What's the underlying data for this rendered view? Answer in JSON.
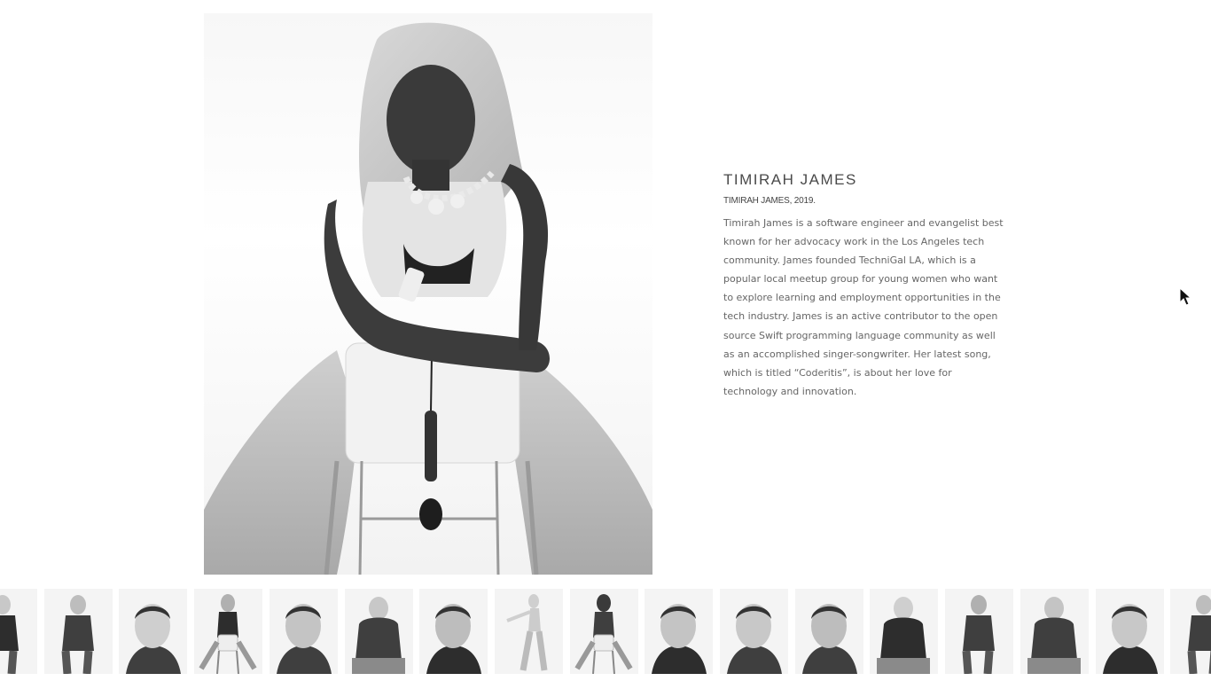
{
  "profile": {
    "name": "TIMIRAH JAMES",
    "caption": "TIMIRAH JAMES, 2019.",
    "bio": "Timirah James is a software engineer and evangelist best known for her advocacy work in the Los Angeles tech community. James founded TechniGal LA, which is a popular local meetup group for young women who want to explore learning and employment opportunities in the tech industry. James is an active contributor to the open source Swift programming language community as well as an accomplished singer-songwriter. Her latest song, which is titled “Coderitis”, is about her love for technology and innovation."
  },
  "main_image": {
    "icon": "portrait-photo-seated-woman"
  },
  "thumbnails": [
    {
      "icon": "portrait-thumb",
      "pose": "standing"
    },
    {
      "icon": "portrait-thumb",
      "pose": "standing"
    },
    {
      "icon": "portrait-thumb",
      "pose": "closeup"
    },
    {
      "icon": "portrait-thumb",
      "pose": "chair"
    },
    {
      "icon": "portrait-thumb",
      "pose": "closeup"
    },
    {
      "icon": "portrait-thumb",
      "pose": "seated"
    },
    {
      "icon": "portrait-thumb",
      "pose": "closeup"
    },
    {
      "icon": "portrait-thumb",
      "pose": "dancing"
    },
    {
      "icon": "portrait-thumb",
      "pose": "chair",
      "selected": true
    },
    {
      "icon": "portrait-thumb",
      "pose": "closeup"
    },
    {
      "icon": "portrait-thumb",
      "pose": "closeup"
    },
    {
      "icon": "portrait-thumb",
      "pose": "closeup"
    },
    {
      "icon": "portrait-thumb",
      "pose": "seated"
    },
    {
      "icon": "portrait-thumb",
      "pose": "standing"
    },
    {
      "icon": "portrait-thumb",
      "pose": "seated"
    },
    {
      "icon": "portrait-thumb",
      "pose": "closeup"
    },
    {
      "icon": "portrait-thumb",
      "pose": "standing"
    }
  ],
  "colors": {
    "name_text": "#4a4a4a",
    "body_text": "#666666",
    "background": "#ffffff"
  }
}
